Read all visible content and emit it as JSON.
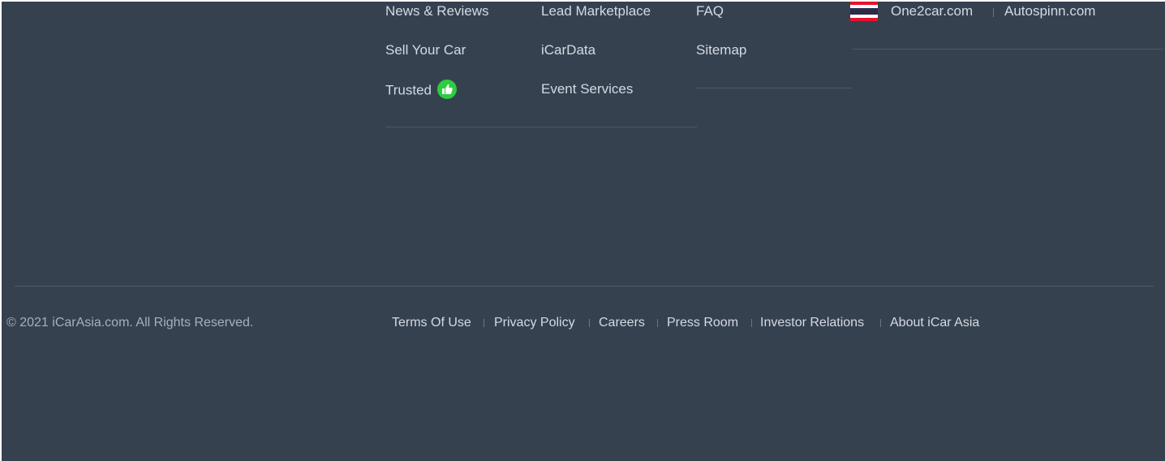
{
  "links": {
    "col1": [
      "News & Reviews",
      "Sell Your Car",
      "Trusted"
    ],
    "col2": [
      "Lead Marketplace",
      "iCarData",
      "Event Services"
    ],
    "col3": [
      "FAQ",
      "Sitemap"
    ]
  },
  "network": {
    "country_flag": "thailand-flag-icon",
    "sites": [
      "One2car.com",
      "Autospinn.com"
    ]
  },
  "footer": {
    "copyright": "© 2021 iCarAsia.com. All Rights Reserved.",
    "legal_links": [
      "Terms Of Use",
      "Privacy Policy",
      "Careers",
      "Press Room",
      "Investor Relations",
      "About iCar Asia"
    ]
  },
  "colors": {
    "background": "#364150",
    "trusted_badge": "#2ecc40",
    "link_text": "#d3dae2"
  }
}
